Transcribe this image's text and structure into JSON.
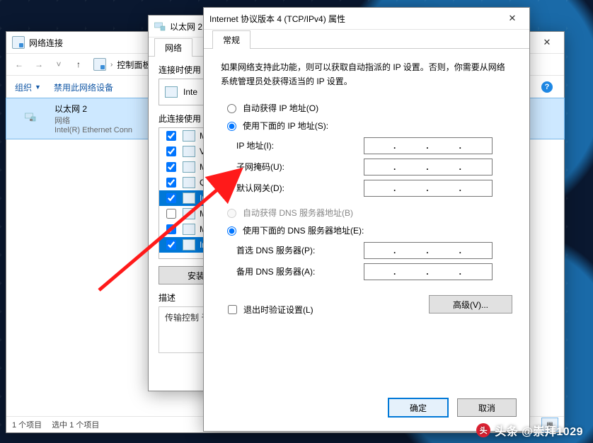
{
  "explorer": {
    "title": "网络连接",
    "breadcrumb": "控制面板",
    "cmd_organize": "组织",
    "cmd_disable": "禁用此网络设备",
    "item_name": "以太网 2",
    "item_sub1": "网络",
    "item_sub2": "Intel(R) Ethernet Conn",
    "status_count": "1 个项目",
    "status_selected": "选中 1 个项目"
  },
  "eth_props": {
    "title": "以太网 2 属性",
    "tab": "网络",
    "label_connect_using": "连接时使用",
    "adapter_name": "Inte",
    "label_items": "此连接使用",
    "items": [
      {
        "checked": true,
        "label": "Mi"
      },
      {
        "checked": true,
        "label": "VN"
      },
      {
        "checked": true,
        "label": "Mi"
      },
      {
        "checked": true,
        "label": "Qo"
      },
      {
        "checked": true,
        "label": "Int",
        "selected": true
      },
      {
        "checked": false,
        "label": "Mi"
      },
      {
        "checked": true,
        "label": "Mi"
      },
      {
        "checked": true,
        "label": "Int",
        "selected": true
      }
    ],
    "btn_install": "安装",
    "desc_title": "描述",
    "desc_text": "传输控制\n于在不同"
  },
  "ipv4": {
    "title": "Internet 协议版本 4 (TCP/IPv4) 属性",
    "tab": "常规",
    "info": "如果网络支持此功能，则可以获取自动指派的 IP 设置。否则，你需要从网络系统管理员处获得适当的 IP 设置。",
    "radio_auto_ip": "自动获得 IP 地址(O)",
    "radio_manual_ip": "使用下面的 IP 地址(S):",
    "field_ip": "IP 地址(I):",
    "field_mask": "子网掩码(U):",
    "field_gw": "默认网关(D):",
    "radio_auto_dns": "自动获得 DNS 服务器地址(B)",
    "radio_manual_dns": "使用下面的 DNS 服务器地址(E):",
    "field_dns1": "首选 DNS 服务器(P):",
    "field_dns2": "备用 DNS 服务器(A):",
    "chk_validate": "退出时验证设置(L)",
    "btn_advanced": "高级(V)...",
    "btn_ok": "确定",
    "btn_cancel": "取消"
  },
  "watermark": "头条 @崇拜1029"
}
